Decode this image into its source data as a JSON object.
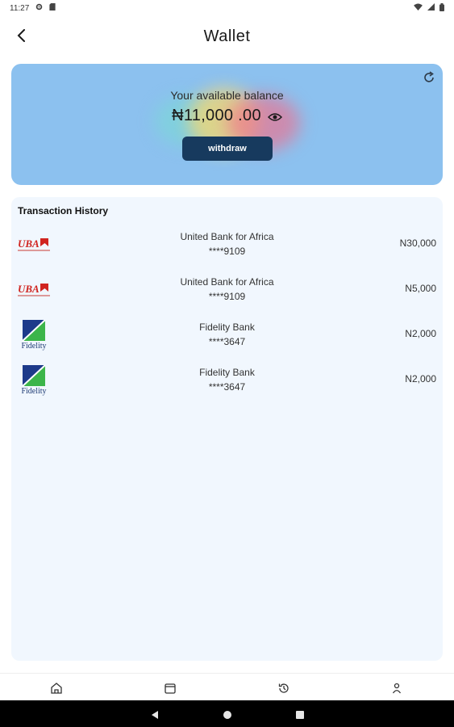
{
  "status_bar": {
    "time": "11:27",
    "icons": [
      "gear-icon",
      "sd-card-icon",
      "wifi-icon",
      "signal-icon",
      "battery-icon"
    ]
  },
  "app_bar": {
    "title": "Wallet",
    "back_icon": "chevron-left-icon"
  },
  "balance_card": {
    "label": "Your available balance",
    "amount": "₦11,000 .00",
    "withdraw_label": "withdraw",
    "refresh_icon": "refresh-icon",
    "visibility_icon": "eye-icon",
    "background_color": "#8cc1ef",
    "button_color": "#173a5e"
  },
  "history": {
    "title": "Transaction History",
    "transactions": [
      {
        "bank": "United Bank for Africa",
        "account": "****9109",
        "amount": "N30,000",
        "logo": "uba-logo"
      },
      {
        "bank": "United Bank for Africa",
        "account": "****9109",
        "amount": "N5,000",
        "logo": "uba-logo"
      },
      {
        "bank": "Fidelity Bank",
        "account": "****3647",
        "amount": "N2,000",
        "logo": "fidelity-logo"
      },
      {
        "bank": "Fidelity Bank",
        "account": "****3647",
        "amount": "N2,000",
        "logo": "fidelity-logo"
      }
    ],
    "uba_logo_text": "UBA",
    "fidelity_logo_text": "Fidelity"
  },
  "bottom_nav": {
    "items": [
      "home-icon",
      "wallet-icon",
      "history-icon",
      "profile-icon"
    ]
  },
  "system_nav": {
    "items": [
      "back-triangle-icon",
      "home-circle-icon",
      "recents-square-icon"
    ]
  }
}
